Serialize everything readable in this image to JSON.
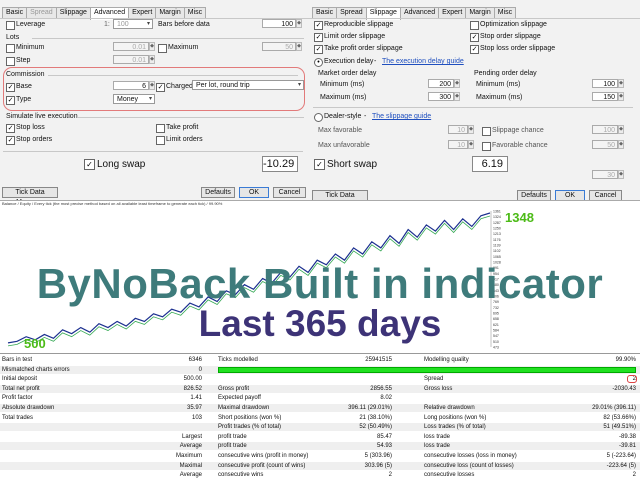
{
  "left": {
    "tabs": [
      {
        "label": "Basic",
        "state": "normal"
      },
      {
        "label": "Spread",
        "state": "disabled"
      },
      {
        "label": "Slippage",
        "state": "normal"
      },
      {
        "label": "Advanced",
        "state": "active"
      },
      {
        "label": "Expert",
        "state": "normal"
      },
      {
        "label": "Margin",
        "state": "normal"
      },
      {
        "label": "Misc",
        "state": "normal"
      }
    ],
    "leverage_label": "Leverage",
    "leverage_prefix": "1:",
    "leverage_value": "100",
    "bars_before_label": "Bars before data",
    "bars_before_value": "100",
    "lots_label": "Lots",
    "minimum_label": "Minimum",
    "minimum_value": "0.01",
    "maximum_label": "Maximum",
    "maximum_value": "50",
    "step_label": "Step",
    "step_value": "0.01",
    "commission_label": "Commission",
    "base_label": "Base",
    "base_value": "6",
    "charged_label": "Charged",
    "charged_value": "Per lot, round trip",
    "type_label": "Type",
    "type_value": "Money",
    "simulate_label": "Simulate live execution",
    "stop_loss_label": "Stop loss",
    "take_profit_label": "Take profit",
    "stop_orders_label": "Stop orders",
    "limit_orders_label": "Limit orders",
    "long_swap_label": "Long swap",
    "long_swap_value": "-10.29",
    "tick_data_manager": "Tick Data Manager",
    "defaults": "Defaults",
    "ok": "OK",
    "cancel": "Cancel"
  },
  "right": {
    "tabs": [
      {
        "label": "Basic",
        "state": "normal"
      },
      {
        "label": "Spread",
        "state": "normal"
      },
      {
        "label": "Slippage",
        "state": "active"
      },
      {
        "label": "Advanced",
        "state": "normal"
      },
      {
        "label": "Expert",
        "state": "normal"
      },
      {
        "label": "Margin",
        "state": "normal"
      },
      {
        "label": "Misc",
        "state": "normal"
      }
    ],
    "reproducible_label": "Reproducible slippage",
    "optimization_label": "Optimization slippage",
    "limit_order_label": "Limit order slippage",
    "stop_order_label": "Stop order slippage",
    "take_profit_label": "Take profit order slippage",
    "stop_loss_order_label": "Stop loss order slippage",
    "execution_delay_label": "Execution delay",
    "dash1": "-",
    "execution_delay_link": "The execution delay guide",
    "market_order_delay": "Market order delay",
    "pending_order_delay": "Pending order delay",
    "minimum_ms_label": "Minimum (ms)",
    "maximum_ms_label": "Maximum (ms)",
    "market_min": "200",
    "market_max": "300",
    "pending_min": "100",
    "pending_max": "150",
    "dealer_style_label": "Dealer-style",
    "dash2": "-",
    "slippage_link": "The slippage guide",
    "max_favorable_label": "Max favorable",
    "max_favorable_value": "10",
    "slippage_chance_label": "Slippage chance",
    "slippage_chance_value": "100",
    "max_unfavorable_label": "Max unfavorable",
    "max_unfavorable_value": "10",
    "favorable_chance_label": "Favorable chance",
    "favorable_chance_value": "50",
    "short_swap_label": "Short swap",
    "short_swap_value": "6.19",
    "extra_value": "30",
    "tick_data_manager": "Tick Data Manager",
    "defaults": "Defaults",
    "ok": "OK",
    "cancel": "Cancel"
  },
  "chart": {
    "header": "Balance / Equity / Every tick (the most precise method based on all available least timeframe to generate each tick) / 99.90%",
    "start_label": "500",
    "end_label": "1348",
    "y_ticks": [
      "1361",
      "1324",
      "1287",
      "1250",
      "1213",
      "1176",
      "1139",
      "1102",
      "1065",
      "1028",
      "991",
      "954",
      "917",
      "880",
      "843",
      "806",
      "769",
      "732",
      "695",
      "658",
      "621",
      "584",
      "547",
      "510",
      "473"
    ],
    "colors": {
      "balance": "#1b2f8f",
      "equity": "#34a853",
      "start": "#4cbb17",
      "end": "#4cbb17"
    },
    "chart_data": {
      "type": "line",
      "series": [
        {
          "name": "Balance",
          "values": [
            500,
            510,
            540,
            520,
            555,
            530,
            585,
            560,
            600,
            570,
            625,
            600,
            640,
            610,
            660,
            640,
            690,
            670,
            720,
            700,
            760,
            735,
            800,
            770,
            840,
            815,
            880,
            850,
            920,
            890,
            960,
            930,
            1000,
            960,
            1040,
            1010,
            1080,
            1040,
            1120,
            1080,
            1160,
            1120,
            1200,
            1150,
            1240,
            1190,
            1270,
            1230,
            1300,
            1240,
            1310,
            1260,
            1330,
            1348
          ]
        }
      ]
    }
  },
  "overlay": {
    "title": "ByNoBack Built in indicator",
    "subtitle": "Last 365 days"
  },
  "stats": {
    "quality_bar_color": "#21e121",
    "rows": [
      [
        "Bars in test",
        "6346",
        "Ticks modelled",
        "25941515",
        "Modelling quality",
        "99.90%"
      ],
      [
        "Mismatched charts errors",
        "0",
        "",
        "",
        "",
        ""
      ],
      [
        "Initial deposit",
        "500.00",
        "",
        "",
        "Spread",
        "2"
      ],
      [
        "Total net profit",
        "826.52",
        "Gross profit",
        "2856.55",
        "Gross loss",
        "-2030.43"
      ],
      [
        "Profit factor",
        "1.41",
        "Expected payoff",
        "8.02",
        "",
        ""
      ],
      [
        "Absolute drawdown",
        "35.97",
        "Maximal drawdown",
        "396.11 (29.01%)",
        "Relative drawdown",
        "29.01% (396.11)"
      ],
      [
        "Total trades",
        "103",
        "Short positions (won %)",
        "21 (38.10%)",
        "Long positions (won %)",
        "82 (53.66%)"
      ],
      [
        "",
        "",
        "Profit trades (% of total)",
        "52 (50.49%)",
        "Loss trades (% of total)",
        "51 (49.51%)"
      ],
      [
        "",
        "Largest",
        "profit trade",
        "85.47",
        "loss trade",
        "-89.38"
      ],
      [
        "",
        "Average",
        "profit trade",
        "54.93",
        "loss trade",
        "-39.81"
      ],
      [
        "",
        "Maximum",
        "consecutive wins (profit in money)",
        "5 (303.96)",
        "consecutive losses (loss in money)",
        "5 (-223.64)"
      ],
      [
        "",
        "Maximal",
        "consecutive profit (count of wins)",
        "303.96 (5)",
        "consecutive loss (count of losses)",
        "-223.64 (5)"
      ],
      [
        "",
        "Average",
        "consecutive wins",
        "2",
        "consecutive losses",
        "2"
      ]
    ]
  }
}
